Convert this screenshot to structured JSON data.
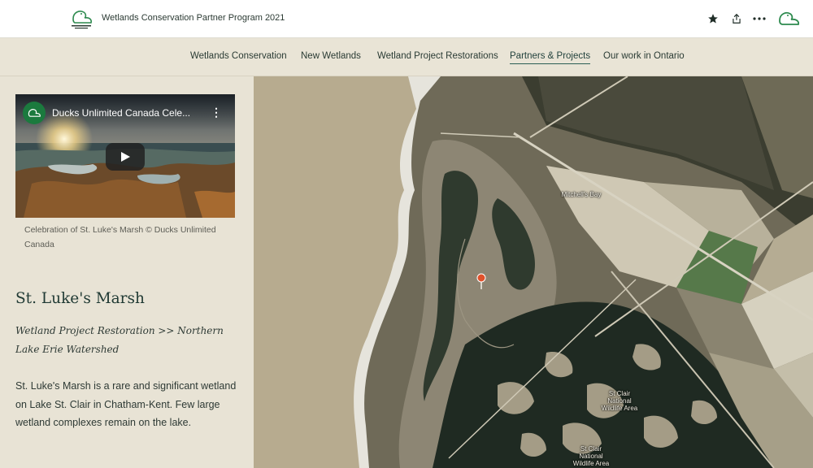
{
  "header": {
    "app_title": "Wetlands Conservation Partner Program 2021",
    "logo_icon": "ducks-unlimited-logo",
    "icons": [
      "star-icon",
      "share-icon",
      "more-icon",
      "duck-logo-icon"
    ]
  },
  "nav": {
    "items": [
      {
        "label": "Wetlands Conservation"
      },
      {
        "label": "New Wetlands"
      },
      {
        "label": "Wetland Project Restorations"
      },
      {
        "label": "Partners & Projects",
        "active": true
      },
      {
        "label": "Our work in Ontario"
      }
    ]
  },
  "video": {
    "title": "Ducks Unlimited Canada Cele...",
    "caption": "Celebration of St. Luke's Marsh © Ducks Unlimited Canada"
  },
  "story": {
    "title": "St. Luke's Marsh",
    "subtitle": "Wetland Project Restoration >> Northern Lake Erie Watershed",
    "body": "St. Luke's Marsh is a rare and significant wetland on Lake St. Clair in Chatham-Kent. Few large wetland complexes remain on the lake."
  },
  "map": {
    "labels": {
      "mitchells_bay": "Mitchell's Bay",
      "nwa_1": "St Clair National Wildlife Area",
      "nwa_2": "St Clair National Wildlife Area"
    }
  },
  "colors": {
    "accent": "#2c5f55",
    "nav_bg": "#e9e4d6",
    "panel_bg": "#e8e3d5",
    "lake": "#b7ab8f",
    "pin": "#e0522c"
  }
}
